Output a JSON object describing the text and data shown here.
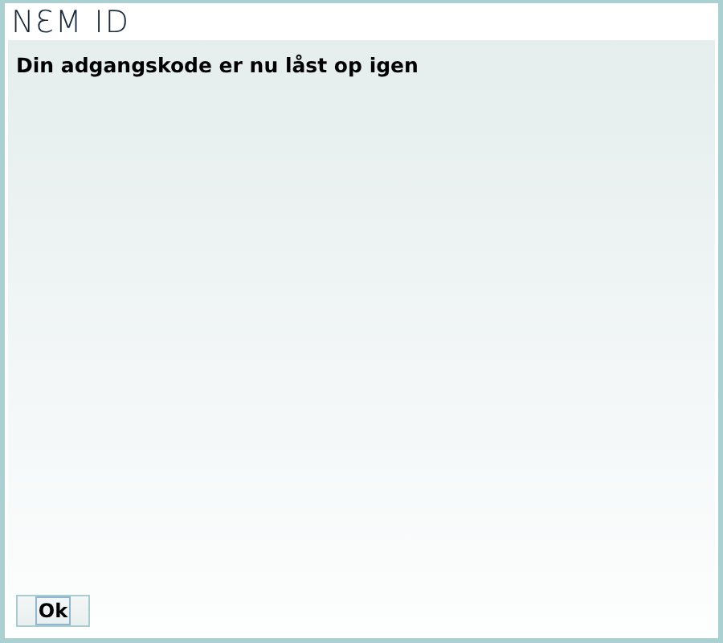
{
  "logo": {
    "text": "NƐM ID"
  },
  "message": "Din adgangskode er nu låst op igen",
  "buttons": [
    {
      "label": "Ok",
      "focused": true
    }
  ]
}
